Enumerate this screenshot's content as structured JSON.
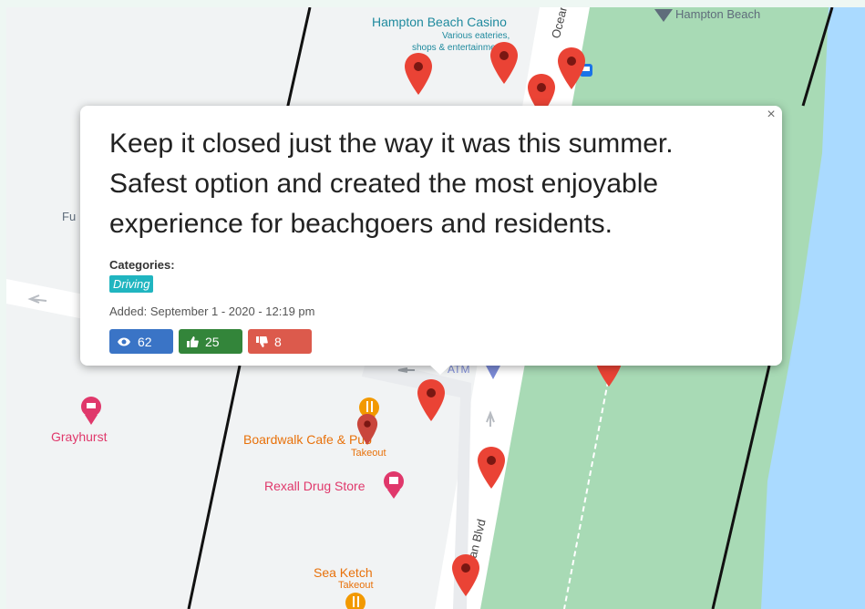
{
  "map": {
    "labels": {
      "hampton_beach": "Hampton Beach",
      "casino_name": "Hampton Beach Casino",
      "casino_desc_1": "Various eateries,",
      "casino_desc_2": "shops & entertainment",
      "ocean_blvd_top": "Ocean Bl",
      "ocean_blvd_bottom": "Ocean Blvd",
      "partial_left": "Fu",
      "grayhurst": "Grayhurst",
      "boardwalk": "Boardwalk Cafe & Pub",
      "boardwalk_sub": "Takeout",
      "rexall": "Rexall Drug Store",
      "sea_ketch": "Sea Ketch",
      "sea_ketch_sub": "Takeout",
      "atm": "ATM"
    },
    "colors": {
      "land": "#f1f3f4",
      "park": "#a8dab5",
      "water": "#aadaff",
      "pin": "#ea4335",
      "road_line": "#111111"
    }
  },
  "popup": {
    "comment": "Keep it closed just the way it was this summer. Safest option and created the most enjoyable experience for beachgoers and residents.",
    "categories_label": "Categories:",
    "category": "Driving",
    "added": "Added: September 1 - 2020 - 12:19 pm",
    "close_symbol": "×",
    "stats": {
      "views": "62",
      "likes": "25",
      "dislikes": "8"
    },
    "colors": {
      "views": "#3a74c6",
      "likes": "#33853a",
      "dislikes": "#dc5a4c",
      "tag": "#20b5c0"
    },
    "icons": {
      "views": "eye-icon",
      "likes": "thumbs-up-icon",
      "dislikes": "thumbs-down-icon",
      "close": "close-icon"
    }
  }
}
